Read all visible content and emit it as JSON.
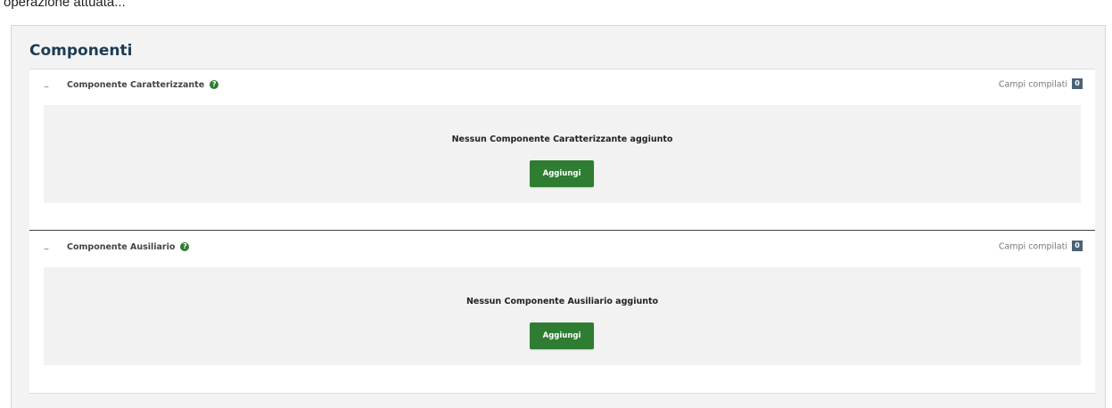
{
  "caption": "operazione attuata...",
  "panel": {
    "title": "Componenti"
  },
  "sections": [
    {
      "label": "Componente Caratterizzante",
      "help_icon": "?",
      "toggle": "–",
      "campi_label": "Campi compilati",
      "campi_count": "0",
      "empty_message": "Nessun Componente Caratterizzante aggiunto",
      "add_button": "Aggiungi"
    },
    {
      "label": "Componente Ausiliario",
      "help_icon": "?",
      "toggle": "–",
      "campi_label": "Campi compilati",
      "campi_count": "0",
      "empty_message": "Nessun Componente Ausiliario aggiunto",
      "add_button": "Aggiungi"
    }
  ],
  "colors": {
    "accent_green": "#2e7d32",
    "title_blue": "#1d3c54",
    "count_badge": "#4a6274"
  }
}
